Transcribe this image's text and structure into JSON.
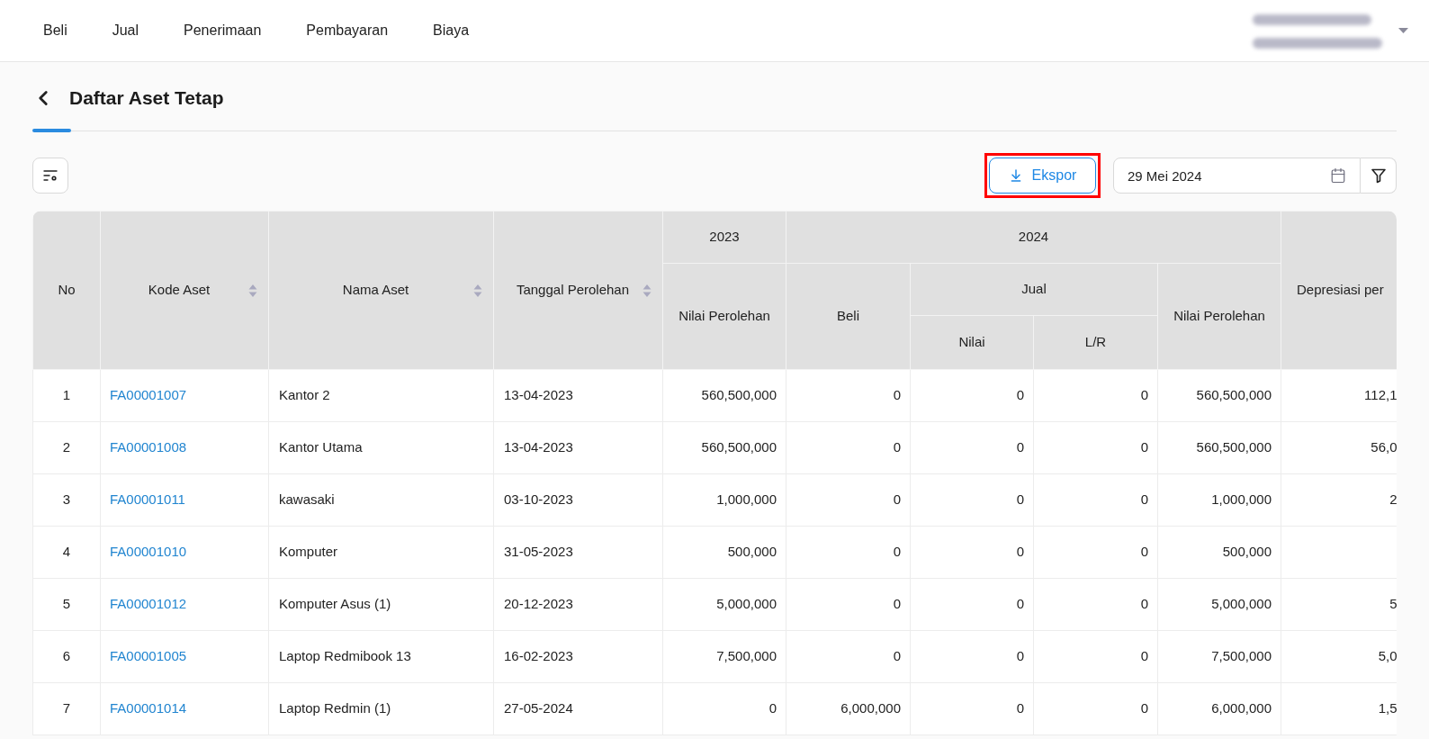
{
  "top_nav": {
    "items": [
      {
        "label": "Beli"
      },
      {
        "label": "Jual"
      },
      {
        "label": "Penerimaan"
      },
      {
        "label": "Pembayaran"
      },
      {
        "label": "Biaya"
      }
    ]
  },
  "page": {
    "title": "Daftar Aset Tetap"
  },
  "toolbar": {
    "export_button": {
      "label": "Ekspor",
      "highlighted": true
    },
    "date_field": {
      "value": "29 Mei 2024"
    }
  },
  "table": {
    "columns": [
      {
        "label": "No",
        "sortable": false
      },
      {
        "label": "Kode Aset",
        "sortable": true
      },
      {
        "label": "Nama Aset",
        "sortable": true
      },
      {
        "label": "Tanggal Perolehan",
        "sortable": true
      },
      {
        "label": "2023",
        "sortable": false,
        "children": [
          {
            "label": "Nilai Perolehan",
            "sortable": false
          }
        ]
      },
      {
        "label": "2024",
        "sortable": false,
        "children": [
          {
            "label": "Beli",
            "sortable": false
          },
          {
            "label": "Jual",
            "sortable": false,
            "children": [
              {
                "label": "Nilai",
                "sortable": false
              },
              {
                "label": "L/R",
                "sortable": false
              }
            ]
          },
          {
            "label": "Nilai Perolehan",
            "sortable": false
          }
        ]
      },
      {
        "label": "Depresiasi per",
        "sortable": false
      }
    ],
    "rows": [
      {
        "no": "1",
        "code": "FA00001007",
        "name": "Kantor 2",
        "acquired_date": "13-04-2023",
        "values": [
          "560,500,000",
          "0",
          "0",
          "0",
          "560,500,000"
        ],
        "depreciation": "112,1"
      },
      {
        "no": "2",
        "code": "FA00001008",
        "name": "Kantor Utama",
        "acquired_date": "13-04-2023",
        "values": [
          "560,500,000",
          "0",
          "0",
          "0",
          "560,500,000"
        ],
        "depreciation": "56,0"
      },
      {
        "no": "3",
        "code": "FA00001011",
        "name": "kawasaki",
        "acquired_date": "03-10-2023",
        "values": [
          "1,000,000",
          "0",
          "0",
          "0",
          "1,000,000"
        ],
        "depreciation": "2"
      },
      {
        "no": "4",
        "code": "FA00001010",
        "name": "Komputer",
        "acquired_date": "31-05-2023",
        "values": [
          "500,000",
          "0",
          "0",
          "0",
          "500,000"
        ]
      },
      {
        "no": "5",
        "code": "FA00001012",
        "name": "Komputer Asus (1)",
        "acquired_date": "20-12-2023",
        "values": [
          "5,000,000",
          "0",
          "0",
          "0",
          "5,000,000"
        ],
        "depreciation": "5"
      },
      {
        "no": "6",
        "code": "FA00001005",
        "name": "Laptop Redmibook 13",
        "acquired_date": "16-02-2023",
        "values": [
          "7,500,000",
          "0",
          "0",
          "0",
          "7,500,000"
        ],
        "depreciation": "5,0"
      },
      {
        "no": "7",
        "code": "FA00001014",
        "name": "Laptop Redmin (1)",
        "acquired_date": "27-05-2024",
        "values": [
          "0",
          "6,000,000",
          "0",
          "0",
          "6,000,000"
        ],
        "depreciation": "1,5"
      }
    ]
  }
}
